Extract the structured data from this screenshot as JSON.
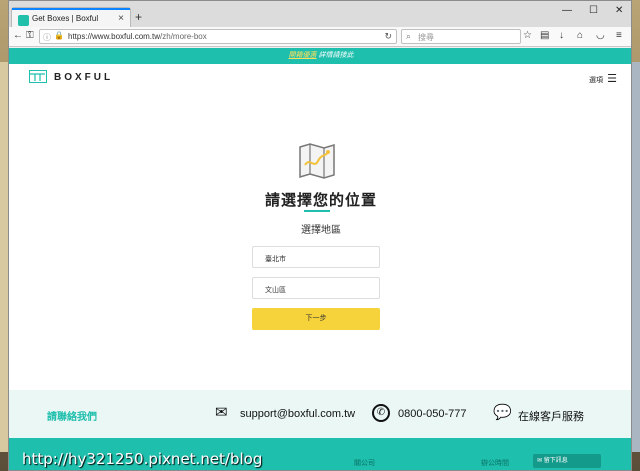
{
  "browser": {
    "tab_title": "Get Boxes | Boxful",
    "new_tab": "+",
    "tab_close": "×",
    "url_host": "https://www.boxful.com.tw",
    "url_path": "/zh/more-box",
    "search_placeholder": "搜尋",
    "window_controls": [
      "—",
      "☐",
      "✕"
    ]
  },
  "site": {
    "promo_link": "開箱優惠",
    "promo_rest": " 詳情請接此",
    "logo_text": "BOXFUL",
    "menu_label": "選項",
    "heading": "請選擇您的位置",
    "subheading": "選擇地區",
    "city_value": "臺北市",
    "district_value": "文山區",
    "next_button": "下一步"
  },
  "contact": {
    "label": "請聯絡我們",
    "email": "support@boxful.com.tw",
    "phone": "0800-050-777",
    "chat": "在線客戶服務"
  },
  "footer": {
    "company": "關公司",
    "hours": "辦公時間",
    "message_button": "留下訊息"
  },
  "watermark": "http://hy321250.pixnet.net/blog",
  "colors": {
    "accent": "#1fbfad",
    "button": "#f6d33b"
  }
}
